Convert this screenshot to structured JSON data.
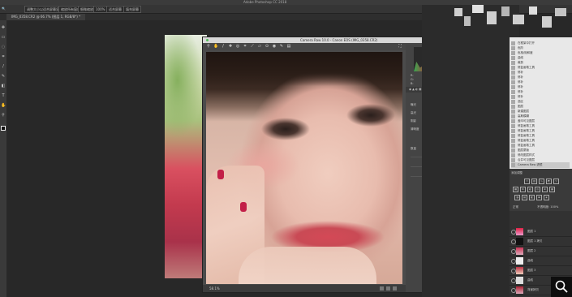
{
  "app_title": "Adobe Photoshop CC 2018",
  "options_bar": {
    "items": [
      "调整大小以适合屏幕显示",
      "缩放所有窗口",
      "细微缩放",
      "100%",
      "适合屏幕",
      "填充屏幕"
    ]
  },
  "document_tab": "IMG_0358.CR2 @ 66.7% (图层 1, RGB/8*) *",
  "camera_raw": {
    "title": "Camera Raw 10.0 - Canon EOS (IMG_0358.CR2)",
    "histogram_readout": [
      "R:",
      "G:",
      "B:",
      "f/1.8  1/1000 秒",
      "ISO 100  85 毫米"
    ],
    "section_title": "基本",
    "sliders": [
      {
        "label": "曝光",
        "value": "0.00",
        "level": 0.55
      },
      {
        "label": "高光",
        "value": "0",
        "level": 0.5
      },
      {
        "label": "阴影",
        "value": "0",
        "level": 0.5
      },
      {
        "label": "清晰度",
        "value": "0",
        "level": 0.65
      }
    ],
    "subsection_title": "细节",
    "sliders2": [
      {
        "label": "数量",
        "value": "0",
        "level": 0.75
      }
    ],
    "zoom": "58.1%"
  },
  "history": {
    "items": [
      "在框架中打开",
      "色阶",
      "色相/饱和度",
      "曲线",
      "裁剪",
      "修复画笔工具",
      "修补",
      "修补",
      "修补",
      "修补",
      "修补",
      "修补",
      "选区",
      "图层",
      "新建图层",
      "高斯模糊",
      "盖印可见图层",
      "修复画笔工具",
      "修复画笔工具",
      "修复画笔工具",
      "修复画笔工具",
      "修复画笔工具",
      "图层蒙版",
      "修改图层样式",
      "合并可见图层",
      "Camera Raw 滤镜"
    ]
  },
  "adjustments": {
    "title": "添加调整"
  },
  "layers": {
    "blend": "正常",
    "opacity": "不透明度: 100%",
    "rows": [
      "图层 1",
      "图层 1 拷贝",
      "图层 2",
      "曲线",
      "图层 3",
      "曲线",
      "背景拷贝",
      "背景"
    ]
  },
  "icons": [
    "move-icon",
    "marquee-icon",
    "lasso-icon",
    "crop-icon",
    "eyedropper-icon",
    "brush-icon",
    "eraser-icon",
    "text-icon",
    "zoom-icon",
    "hand-icon",
    "search-icon"
  ]
}
